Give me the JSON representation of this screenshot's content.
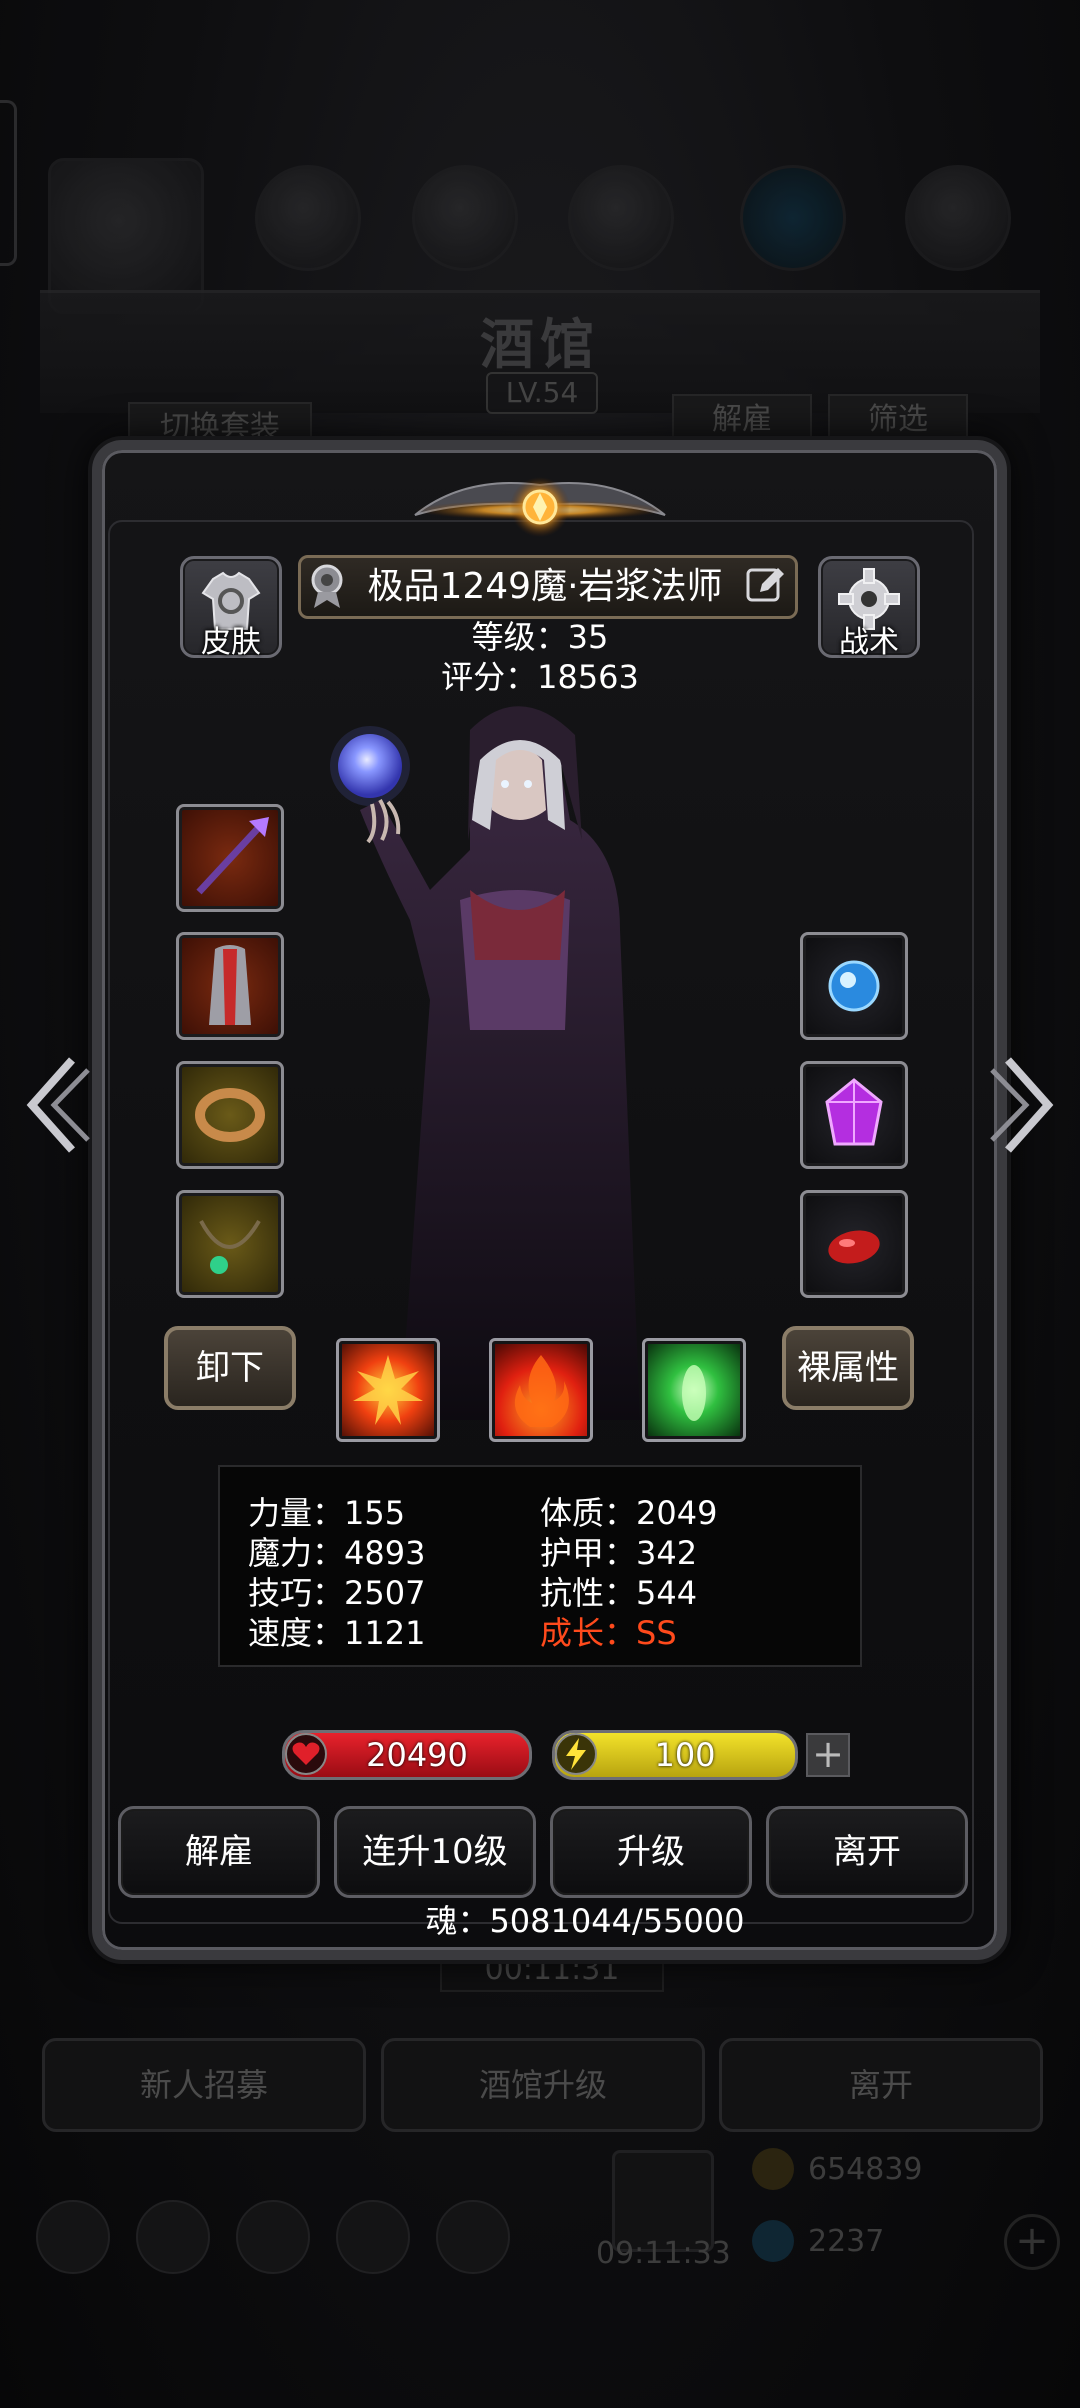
{
  "background": {
    "title": "酒馆",
    "level": "LV.54",
    "tab_switch_outfit": "切换套装",
    "tab_dismiss": "解雇",
    "tab_filter": "筛选",
    "timer": "00:11:31",
    "btn_recruit": "新人招募",
    "btn_upgrade_tavern": "酒馆升级",
    "btn_leave": "离开",
    "gold": "654839",
    "bottom_timer": "09:11:33",
    "gems": "2237"
  },
  "hero": {
    "name": "极品1249魔·岩浆法师",
    "level_line": "等级：35",
    "score_line": "评分：18563",
    "skin_label": "皮肤",
    "tactics_label": "战术",
    "unequip_label": "卸下",
    "base_attr_label": "裸属性"
  },
  "stats": {
    "strength": "力量：155",
    "constitution": "体质：2049",
    "magic": "魔力：4893",
    "armor": "护甲：342",
    "skill": "技巧：2507",
    "resist": "抗性：544",
    "speed": "速度：1121",
    "growth": "成长：SS"
  },
  "bars": {
    "hp": "20490",
    "energy": "100",
    "energy_plus": "+"
  },
  "actions": {
    "dismiss": "解雇",
    "level_up_10": "连升10级",
    "level_up": "升级",
    "leave": "离开"
  },
  "soul": "魂：5081044/55000",
  "colors": {
    "growth": "#ff4a1c",
    "hp_bar": "#c8101c",
    "energy_bar": "#e2d21a"
  },
  "icons": {
    "skin": "shirt-swap-icon",
    "tactics": "gear-icon",
    "weapon": "staff-icon",
    "armor": "robe-icon",
    "ring": "ring-icon",
    "necklace": "necklace-icon",
    "orb": "blue-orb-icon",
    "gem": "purple-gem-icon",
    "stone": "red-stone-icon"
  }
}
